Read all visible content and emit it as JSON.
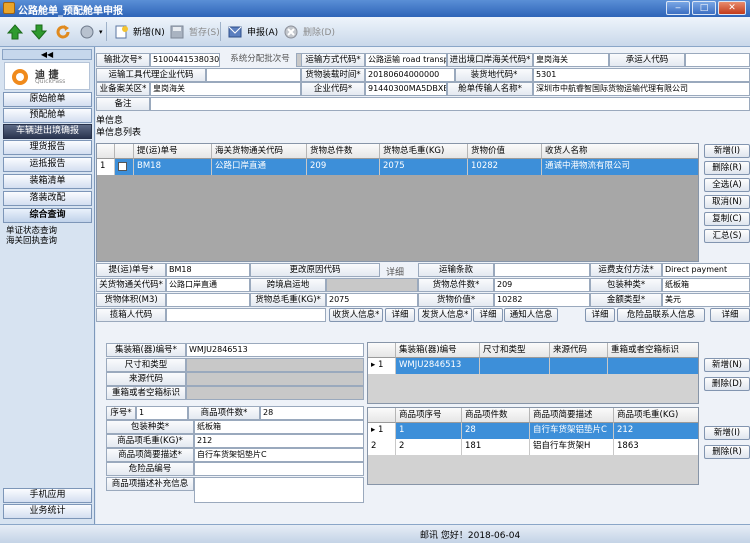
{
  "window": {
    "title": "公路舱单_预配舱单申报"
  },
  "toolbar": {
    "new_label": "新增(N)",
    "save_label": "暂存(S)",
    "declare_label": "申报(A)",
    "delete_label": "删除(D)"
  },
  "sidebar": {
    "collapse_label": "◀◀",
    "logo_text": "迪 捷",
    "logo_sub": "QuickPass",
    "items": [
      "原始舱单",
      "预配舱单",
      "车辆进出境确报",
      "理货报告",
      "运抵报告",
      "装箱清单",
      "落装改配",
      "综合查询"
    ],
    "sublinks": [
      "单证状态查询",
      "海关回执查询"
    ],
    "bottom_items": [
      "手机应用",
      "业务统计"
    ]
  },
  "header_form": {
    "manifest_batch_label": "输批次号*",
    "manifest_batch_value": "5100441538030",
    "system_batch_label": "系统分配批次号",
    "transport_mode_label": "运输方式代码*",
    "transport_mode_value": "公路运输 road transport",
    "customs_code_label": "进出境口岸海关代码*",
    "customs_code_value": "皇岗海关",
    "carrier_code_label": "承运人代码",
    "agent_code_label": "运输工具代理企业代码",
    "load_time_label": "货物装载时间*",
    "load_time_value": "20180604000000",
    "load_place_label": "装货地代码*",
    "load_place_value": "5301",
    "record_area_label": "业备案关区*",
    "record_area_value": "皇岗海关",
    "enterprise_code_label": "企业代码*",
    "enterprise_code_value": "91440300MA5DBXBU7H",
    "sender_name_label": "舱单传输人名称*",
    "sender_name_value": "深圳市中航睿智国际货物运输代理有限公司",
    "remark_label": "备注"
  },
  "sections": {
    "manifest_info": "单信息",
    "manifest_list": "单信息列表"
  },
  "bill_grid": {
    "headers": [
      "提(运)单号",
      "海关货物通关代码",
      "货物总件数",
      "货物总毛重(KG)",
      "货物价值",
      "收货人名称"
    ],
    "rows": [
      {
        "idx": "1",
        "bill_no": "BM18",
        "customs": "公路口岸直通",
        "pieces": "209",
        "weight": "2075",
        "value": "10282",
        "consignee": "通诚中港物流有限公司"
      }
    ]
  },
  "right_buttons": [
    "新增(I)",
    "删除(R)",
    "全选(A)",
    "取消(N)",
    "复制(C)",
    "汇总(S)"
  ],
  "bill_form": {
    "bill_no_label": "提(运)单号*",
    "bill_no_value": "BM18",
    "change_reason_label": "更改原因代码",
    "detail_label": "详细",
    "freight_label": "运输条款",
    "payment_label": "运费支付方法*",
    "payment_value": "Direct payment",
    "customs_code_label": "关货物通关代码*",
    "customs_code_value": "公路口岸直通",
    "transit_label": "跨境启运地",
    "total_pieces_label": "货物总件数*",
    "total_pieces_value": "209",
    "package_label": "包装种类*",
    "package_value": "纸板箱",
    "volume_label": "货物体积(M3)",
    "gross_weight_label": "货物总毛重(KG)*",
    "gross_weight_value": "2075",
    "goods_value_label": "货物价值*",
    "goods_value_value": "10282",
    "currency_label": "金额类型*",
    "currency_value": "美元",
    "receipt_agent_label": "揽箱人代码",
    "consignee_btn": "收货人信息*",
    "detail_btn": "详细",
    "shipper_btn": "发货人信息*",
    "detail_btn2": "详细",
    "notify_btn": "通知人信息",
    "detail_btn3": "详细",
    "danger_btn": "危险品联系人信息",
    "detail_btn4": "详细"
  },
  "container_form": {
    "container_no_label": "集装箱(器)编号*",
    "container_no_value": "WMJU2846513",
    "size_label": "尺寸和类型",
    "source_label": "来源代码",
    "weight_flag_label": "重箱或者空箱标识"
  },
  "container_grid": {
    "headers": [
      "集装箱(器)编号",
      "尺寸和类型",
      "来源代码",
      "重箱或者空箱标识"
    ],
    "rows": [
      {
        "idx": "1",
        "no": "WMJU2846513"
      }
    ]
  },
  "container_buttons": [
    "新增(N)",
    "删除(D)"
  ],
  "goods_form": {
    "seq_label": "序号*",
    "seq_value": "1",
    "item_pieces_label": "商品项件数*",
    "item_pieces_value": "28",
    "package_label": "包装种类*",
    "package_value": "纸板箱",
    "weight_label": "商品项毛重(KG)*",
    "weight_value": "212",
    "desc_label": "商品项简要描述*",
    "desc_value": "自行车货架铝垫片C",
    "danger_label": "危险品编号",
    "supplement_label": "商品项描述补充信息"
  },
  "goods_grid": {
    "headers": [
      "商品项序号",
      "商品项件数",
      "商品项简要描述",
      "商品项毛重(KG)"
    ],
    "rows": [
      {
        "idx": "1",
        "seq": "1",
        "pieces": "28",
        "desc": "自行车货架铝垫片C",
        "weight": "212"
      },
      {
        "idx": "2",
        "seq": "2",
        "pieces": "181",
        "desc": "铝自行车货架H",
        "weight": "1863"
      }
    ]
  },
  "goods_buttons": [
    "新增(I)",
    "删除(R)"
  ],
  "statusbar": {
    "text": "邮讯 您好！2018-06-04"
  }
}
